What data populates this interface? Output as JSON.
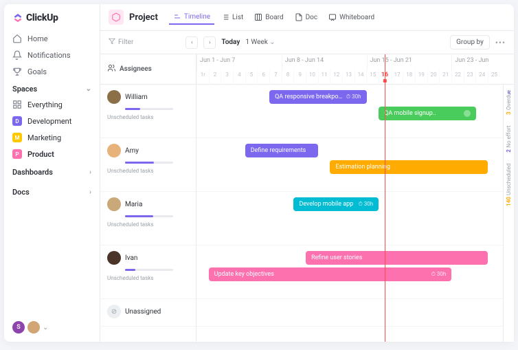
{
  "brand": {
    "name": "ClickUp"
  },
  "nav": {
    "home": "Home",
    "notifications": "Notifications",
    "goals": "Goals"
  },
  "spacesHeader": "Spaces",
  "spaces": {
    "everything": "Everything",
    "items": [
      {
        "letter": "D",
        "label": "Development",
        "color": "#7b68ee"
      },
      {
        "letter": "M",
        "label": "Marketing",
        "color": "#ffc800"
      },
      {
        "letter": "P",
        "label": "Product",
        "color": "#fd71af"
      }
    ]
  },
  "sections": {
    "dashboards": "Dashboards",
    "docs": "Docs"
  },
  "project": {
    "name": "Project"
  },
  "views": {
    "timeline": "Timeline",
    "list": "List",
    "board": "Board",
    "doc": "Doc",
    "whiteboard": "Whiteboard"
  },
  "toolbar": {
    "filter": "Filter",
    "today": "Today",
    "range": "1 Week",
    "groupby": "Group by"
  },
  "timeline": {
    "assigneesHeader": "Assignees",
    "weekRanges": [
      "Jun 1 - Jun 7",
      "Jun 8 - Jun 14",
      "Jun 15 - Jun 21",
      "Jun 23 - Jun"
    ],
    "days": [
      "1r",
      "2",
      "3",
      "4",
      "5",
      "6",
      "7",
      "8",
      "9",
      "10",
      "11",
      "12",
      "13",
      "14",
      "15",
      "16",
      "17",
      "18",
      "19",
      "20",
      "21",
      "22",
      "23",
      "24",
      "25"
    ],
    "todayDay": "16",
    "unscheduledLabel": "Unscheduled tasks",
    "assignees": [
      {
        "name": "William"
      },
      {
        "name": "Amy"
      },
      {
        "name": "Maria"
      },
      {
        "name": "Ivan"
      },
      {
        "name": "Unassigned"
      }
    ],
    "tasks": {
      "william": [
        {
          "label": "QA responsive breakpoints",
          "est": "30h",
          "color": "#7b68ee",
          "startDay": 7,
          "span": 8
        },
        {
          "label": "QA mobile signup..",
          "est": "",
          "color": "#49cc5c",
          "startDay": 16,
          "span": 8,
          "hasIcon": true
        }
      ],
      "amy": [
        {
          "label": "Define requirements",
          "est": "",
          "color": "#7b68ee",
          "startDay": 5,
          "span": 6
        },
        {
          "label": "Estimation planning",
          "est": "",
          "color": "#ffab00",
          "startDay": 12,
          "span": 13
        }
      ],
      "maria": [
        {
          "label": "Develop mobile app",
          "est": "30h",
          "color": "#02bcd4",
          "startDay": 9,
          "span": 7
        }
      ],
      "ivan": [
        {
          "label": "Refine user stories",
          "est": "",
          "color": "#fd71af",
          "startDay": 10,
          "span": 15
        },
        {
          "label": "Update key objectives",
          "est": "30h",
          "color": "#fd71af",
          "startDay": 2,
          "span": 20
        }
      ]
    },
    "rail": {
      "overdue": {
        "n": "3",
        "label": "Overdue",
        "color": "#ffab00"
      },
      "noeffort": {
        "n": "2",
        "label": "No effort",
        "color": "#7b68ee"
      },
      "unscheduled": {
        "n": "140",
        "label": "Unscheduled",
        "color": "#ffab00"
      }
    }
  }
}
